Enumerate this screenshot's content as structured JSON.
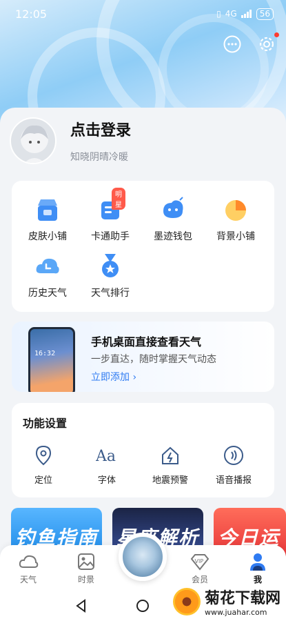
{
  "status_bar": {
    "time": "12:05",
    "network": "4G",
    "battery": "56"
  },
  "profile": {
    "login_label": "点击登录",
    "motto": "知晓阴晴冷暖"
  },
  "features": [
    {
      "label": "皮肤小铺",
      "icon": "shop-icon"
    },
    {
      "label": "卡通助手",
      "icon": "cartoon-assistant-icon",
      "badge": "明星"
    },
    {
      "label": "墨迹钱包",
      "icon": "wallet-icon"
    },
    {
      "label": "背景小铺",
      "icon": "background-shop-icon"
    },
    {
      "label": "历史天气",
      "icon": "history-weather-icon"
    },
    {
      "label": "天气排行",
      "icon": "weather-rank-icon"
    }
  ],
  "banner": {
    "title": "手机桌面直接查看天气",
    "subtitle": "一步直达，随时掌握天气动态",
    "link": "立即添加 ›",
    "phone_time": "16:32"
  },
  "function_settings": {
    "title": "功能设置",
    "items": [
      {
        "label": "定位",
        "icon": "location-icon"
      },
      {
        "label": "字体",
        "icon": "font-icon"
      },
      {
        "label": "地震预警",
        "icon": "earthquake-alert-icon"
      },
      {
        "label": "语音播报",
        "icon": "voice-broadcast-icon"
      }
    ]
  },
  "promos": [
    {
      "label": "钓鱼指南"
    },
    {
      "label": "星座解析"
    },
    {
      "label": "今日运势"
    }
  ],
  "tabs": [
    {
      "label": "天气",
      "icon": "cloud-icon"
    },
    {
      "label": "时景",
      "icon": "image-icon"
    },
    {
      "label": "会员",
      "icon": "vip-icon"
    },
    {
      "label": "我",
      "icon": "person-icon",
      "active": true
    }
  ],
  "watermark": {
    "title": "菊花下载网",
    "url": "www.juahar.com"
  },
  "colors": {
    "accent": "#2f7bf2",
    "badge": "#ff5a4a",
    "active_tab": "#2f7bf2"
  }
}
